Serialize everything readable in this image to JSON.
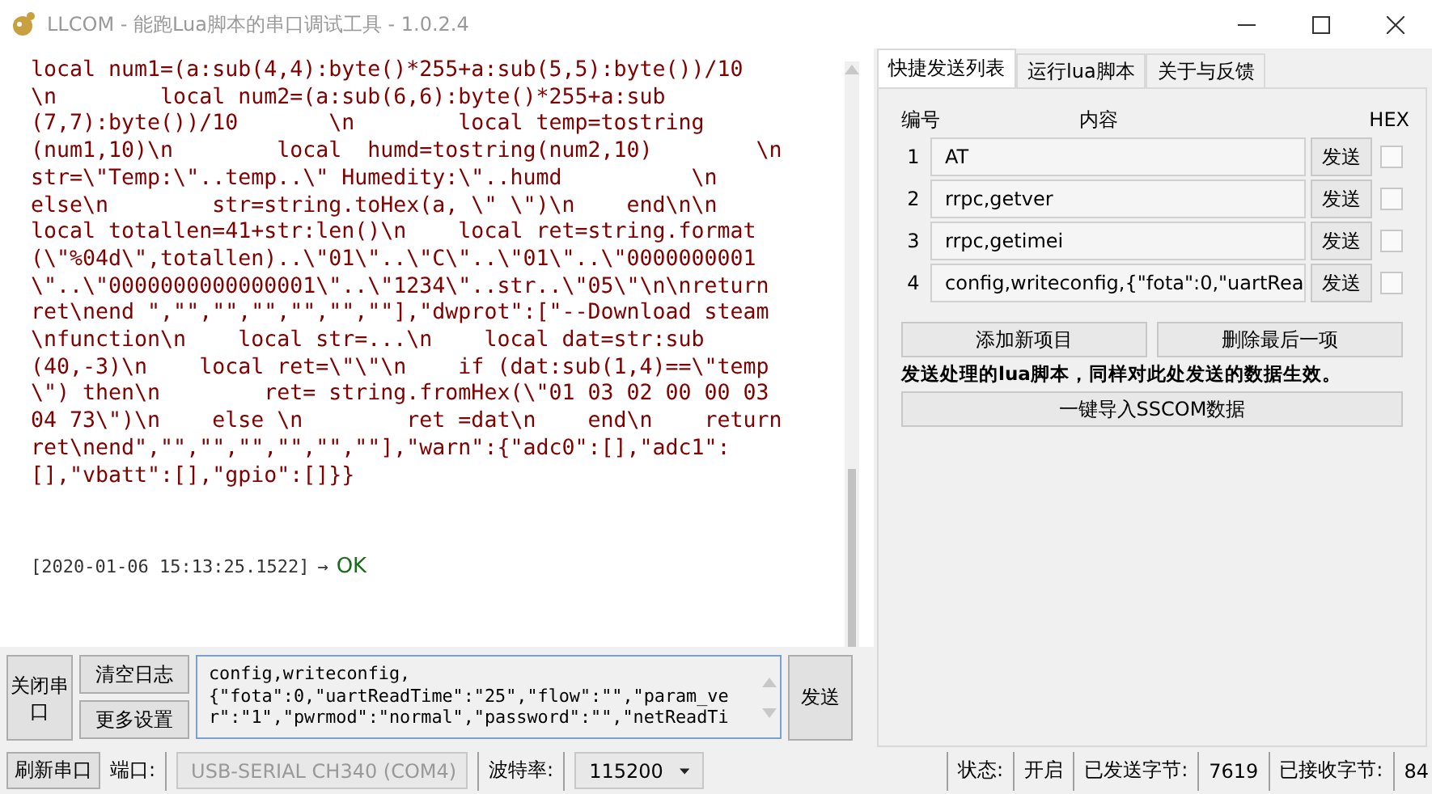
{
  "window": {
    "title": "LLCOM - 能跑Lua脚本的串口调试工具 - 1.0.2.4"
  },
  "log": {
    "lines": [
      "local num1=(a:sub(4,4):byte()*255+a:sub(5,5):byte())/10",
      "\\n        local num2=(a:sub(6,6):byte()*255+a:sub",
      "(7,7):byte())/10       \\n        local temp=tostring",
      "(num1,10)\\n        local  humd=tostring(num2,10)        \\n",
      "str=\\\"Temp:\\\"..temp..\\\" Humedity:\\\"..humd          \\n",
      "else\\n        str=string.toHex(a, \\\" \\\")\\n    end\\n\\n",
      "local totallen=41+str:len()\\n    local ret=string.format",
      "(\\\"%04d\\\",totallen)..\\\"01\\\"..\\\"C\\\"..\\\"01\\\"..\\\"0000000001",
      "\\\"..\\\"0000000000000001\\\"..\\\"1234\\\"..str..\\\"05\\\"\\n\\nreturn",
      "ret\\nend \",\"\",\"\",\"\",\"\",\"\",\"\"],\"dwprot\":[\"--Download steam",
      "\\nfunction\\n    local str=...\\n    local dat=str:sub",
      "(40,-3)\\n    local ret=\\\"\\\"\\n    if (dat:sub(1,4)==\\\"temp",
      "\\\") then\\n        ret= string.fromHex(\\\"01 03 02 00 00 03",
      "04 73\\\")\\n    else \\n        ret =dat\\n    end\\n    return",
      "ret\\nend\",\"\",\"\",\"\",\"\",\"\",\"\"],\"warn\":{\"adc0\":[],\"adc1\":",
      "[],\"vbatt\":[],\"gpio\":[]}}"
    ],
    "timestamp": "[2020-01-06 15:13:25.1522]",
    "arrow": "→",
    "result": "OK"
  },
  "tabs": [
    {
      "label": "快捷发送列表",
      "selected": true
    },
    {
      "label": "运行lua脚本",
      "selected": false
    },
    {
      "label": "关于与反馈",
      "selected": false
    }
  ],
  "quick_send": {
    "columns": [
      "编号",
      "内容",
      "HEX"
    ],
    "rows": [
      {
        "number": "1",
        "value": "AT",
        "button": "发送",
        "hex": false
      },
      {
        "number": "2",
        "value": "rrpc,getver",
        "button": "发送",
        "hex": false
      },
      {
        "number": "3",
        "value": "rrpc,getimei",
        "button": "发送",
        "hex": false
      },
      {
        "number": "4",
        "value": "config,writeconfig,{\"fota\":0,\"uartRea",
        "button": "发送",
        "hex": false
      }
    ],
    "add_button": "添加新项目",
    "delete_button": "删除最后一项",
    "note": "发送处理的lua脚本，同样对此处发送的数据生效。",
    "import_button": "一键导入SSCOM数据"
  },
  "controls": {
    "close_port": "关闭串口",
    "clear_log": "清空日志",
    "more_settings": "更多设置",
    "send_input": {
      "value": "config,writeconfig,\n{\"fota\":0,\"uartReadTime\":\"25\",\"flow\":\"\",\"param_ve\nr\":\"1\",\"pwrmod\":\"normal\",\"password\":\"\",\"netReadTi"
    },
    "send_button": "发送"
  },
  "status_bar": {
    "refresh_button": "刷新串口",
    "port_label": "端口:",
    "port": {
      "value": "USB-SERIAL CH340 (COM4)",
      "disabled": true
    },
    "baud_label": "波特率:",
    "baud": {
      "value": "115200",
      "disabled": false
    },
    "state_label": "状态:",
    "state": "开启",
    "sent_label": "已发送字节:",
    "sent": "7619",
    "received_label": "已接收字节:",
    "received": "84"
  }
}
